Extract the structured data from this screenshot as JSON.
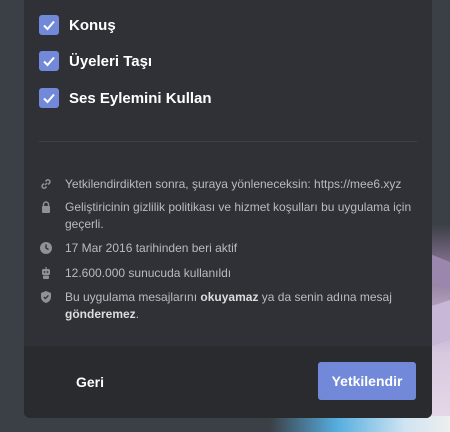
{
  "permissions": [
    {
      "label": "Konuş",
      "checked": true
    },
    {
      "label": "Üyeleri Taşı",
      "checked": true
    },
    {
      "label": "Ses Eylemini Kullan",
      "checked": true
    }
  ],
  "info": {
    "redirect": "Yetkilendirdikten sonra, şuraya yönleneceksin: https://mee6.xyz",
    "privacy": "Geliştiricinin gizlilik politikası ve hizmet koşulları bu uygulama için geçerli.",
    "active_since": "17 Mar 2016 tarihinden beri aktif",
    "servers": "12.600.000 sunucuda kullanıldı",
    "messages_prefix": "Bu uygulama mesajlarını",
    "messages_bold1": "okuyamaz",
    "messages_mid": "ya da senin adına mesaj",
    "messages_bold2": "gönderemez",
    "messages_suffix": "."
  },
  "footer": {
    "back_label": "Geri",
    "authorize_label": "Yetkilendir"
  },
  "colors": {
    "accent": "#7289da",
    "modal_bg": "#2f3136",
    "footer_bg": "#292b2f"
  }
}
